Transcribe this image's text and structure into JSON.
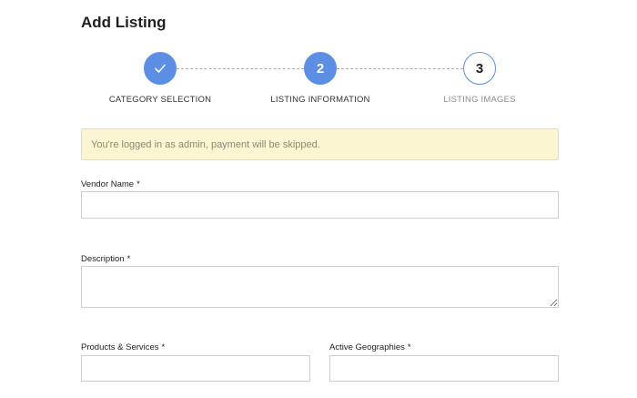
{
  "page": {
    "title": "Add Listing"
  },
  "stepper": {
    "accent_color": "#5c8fe3",
    "steps": [
      {
        "number": "",
        "label": "CATEGORY SELECTION",
        "state": "completed",
        "icon": "check-icon"
      },
      {
        "number": "2",
        "label": "LISTING INFORMATION",
        "state": "active"
      },
      {
        "number": "3",
        "label": "LISTING IMAGES",
        "state": "pending"
      }
    ]
  },
  "notice": {
    "text": "You're logged in as admin, payment will be skipped.",
    "background_color": "#fcf5d2"
  },
  "form": {
    "vendor_name": {
      "label": "Vendor Name",
      "required_mark": "*",
      "value": ""
    },
    "description": {
      "label": "Description",
      "required_mark": "*",
      "value": ""
    },
    "products_services": {
      "label": "Products & Services",
      "required_mark": "*",
      "value": ""
    },
    "active_geographies": {
      "label": "Active Geographies",
      "required_mark": "*",
      "value": ""
    }
  }
}
